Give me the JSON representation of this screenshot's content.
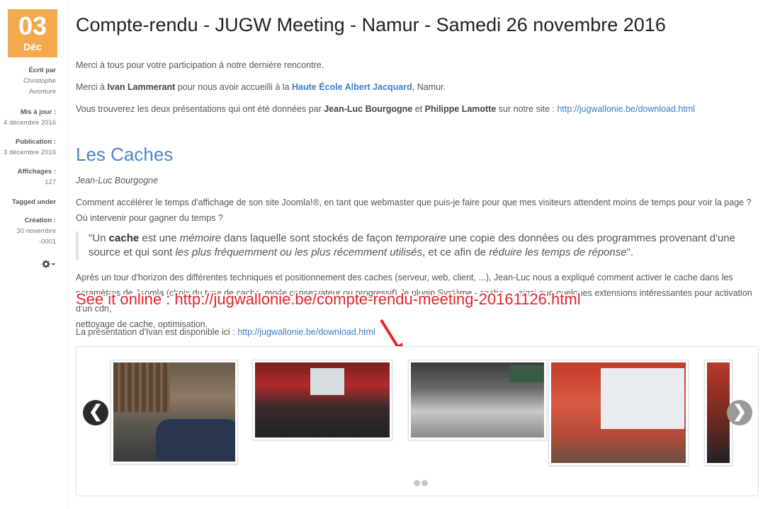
{
  "date": {
    "day": "03",
    "month": "Déc"
  },
  "meta": {
    "written_by_label": "Écrit par",
    "author_line1": "Christophe",
    "author_line2": "Avonture",
    "updated_label": "Mis à jour :",
    "updated_value": "4 décembre 2016",
    "published_label": "Publication :",
    "published_value": "3 décembre 2016",
    "views_label": "Affichages :",
    "views_value": "127",
    "tagged_label": "Tagged under",
    "created_label": "Création :",
    "created_line1": "30 novembre",
    "created_line2": "-0001",
    "gear_icon": "gear-icon"
  },
  "article": {
    "title": "Compte-rendu - JUGW Meeting - Namur - Samedi 26 novembre 2016",
    "p1": "Merci à tous pour votre participation à notre dernière rencontre.",
    "p2_prefix": "Merci à ",
    "p2_name": "Ivan Lammerant",
    "p2_mid": " pour nous avoir accueilli à la ",
    "p2_link": "Haute École Albert Jacquard",
    "p2_suffix": ", Namur.",
    "p3_prefix": "Vous trouverez les deux présentations qui ont été données par ",
    "p3_name1": "Jean-Luc Bourgogne",
    "p3_and": " et ",
    "p3_name2": "Philippe Lamotte",
    "p3_mid": " sur notre site : ",
    "p3_link": "http://jugwallonie.be/download.html",
    "section_title": "Les Caches",
    "section_author": "Jean-Luc Bourgogne",
    "intro": "Comment accélérer le temps d'affichage de son site Joomla!®, en tant que webmaster que puis-je faire pour que mes visiteurs attendent moins de temps pour voir la page ? Où intervenir pour gagner du temps ?",
    "quote": {
      "q1": "\"Un ",
      "q_cache": "cache",
      "q2": " est une ",
      "q_memoire": "mémoire",
      "q3": " dans laquelle sont stockés de façon ",
      "q_temporaire": "temporaire",
      "q4": " une copie des données ou des programmes provenant d'une source et qui sont ",
      "q_freq": "les plus fréquemment ou les plus récemment utilisés",
      "q5": ", et ce afin de ",
      "q_reduire": "réduire les temps de réponse",
      "q6": "\"."
    },
    "p_tour_line1": "Après un tour d'horizon des différentes techniques et positionnement des caches (serveur, web, client, ...), Jean-Luc nous a expliqué comment activer le cache dans les",
    "p_tour_line2": "paramètres de Joomla (choix du type de cache, mode conservateur ou progressif), le plugin Système - cache, ... ainsi que quelques extensions intéressantes pour activation d'un cdn,",
    "p_tour_line3": "nettoyage de cache, optimisation.",
    "p_ivan_prefix": "La présentation d'Ivan est disponible ici : ",
    "p_ivan_link": "http://jugwallonie.be/download.html"
  },
  "overlay_text": "See it online : http://jugwallonie.be/compte-rendu-meeting-20161126.html",
  "carousel": {
    "prev": "❮",
    "next": "❯",
    "slides": [
      "photo-1",
      "photo-2",
      "photo-3",
      "photo-4",
      "photo-5"
    ],
    "dots": 2
  },
  "colors": {
    "accent": "#f4a94e",
    "link": "#3a7dc9",
    "heading": "#4b87c9",
    "overlay": "#e8232a"
  }
}
